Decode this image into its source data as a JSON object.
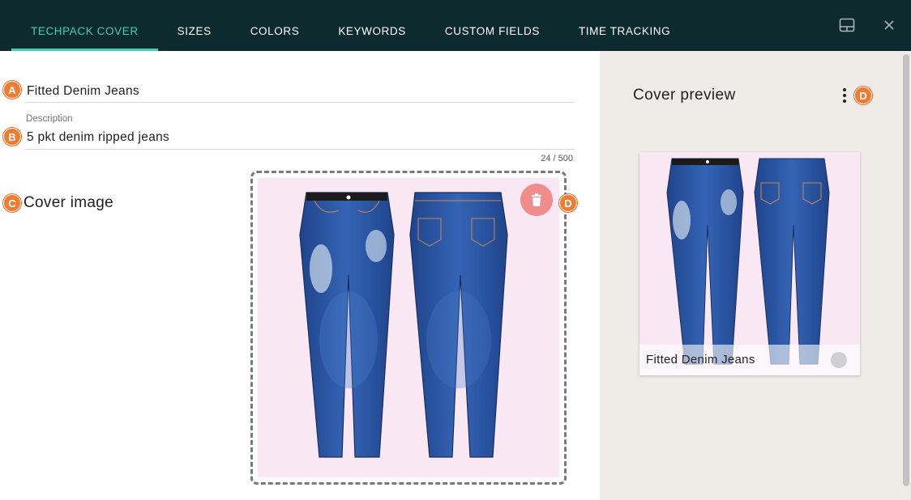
{
  "tabs": [
    {
      "label": "TECHPACK COVER",
      "active": true
    },
    {
      "label": "SIZES",
      "active": false
    },
    {
      "label": "COLORS",
      "active": false
    },
    {
      "label": "KEYWORDS",
      "active": false
    },
    {
      "label": "CUSTOM FIELDS",
      "active": false
    },
    {
      "label": "TIME TRACKING",
      "active": false
    }
  ],
  "header": {
    "layout_icon": "layout-icon",
    "close_icon": "close-icon"
  },
  "form": {
    "name_badge": "A",
    "name_value": "Fitted Denim Jeans",
    "description_label": "Description",
    "description_badge": "B",
    "description_value": "5 pkt denim ripped jeans",
    "counter": "24 / 500",
    "cover_badge": "C",
    "cover_title": "Cover image",
    "delete_badge": "D",
    "delete_icon": "trash-icon"
  },
  "preview": {
    "title": "Cover preview",
    "menu_badge": "D",
    "menu_icon": "more-vertical-icon",
    "card_name": "Fitted Denim Jeans"
  },
  "colors": {
    "header_bg": "#0d2a2e",
    "accent": "#3fd1b1",
    "badge": "#f27b32",
    "delete": "#f08c8c",
    "preview_bg": "#efece8",
    "denim": "#2d58a8"
  }
}
